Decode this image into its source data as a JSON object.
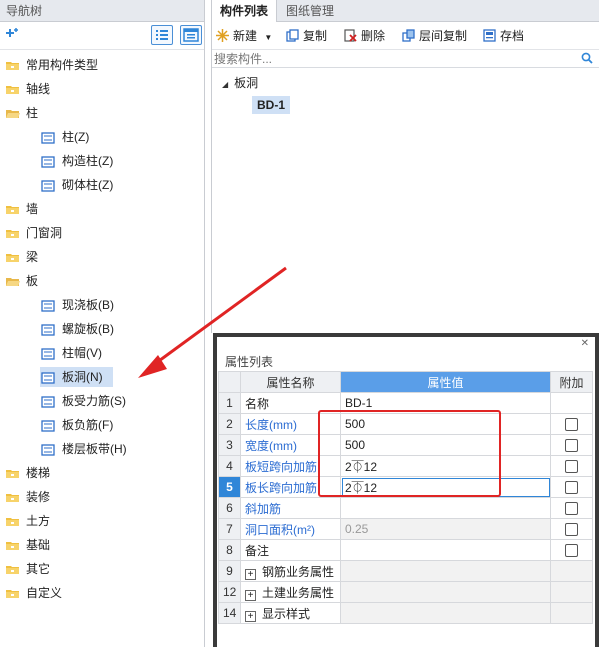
{
  "nav": {
    "title": "导航树",
    "tree": [
      {
        "label": "常用构件类型",
        "kind": "folder"
      },
      {
        "label": "轴线",
        "kind": "folder"
      },
      {
        "label": "柱",
        "kind": "folder-open"
      },
      {
        "label": "柱(Z)",
        "kind": "leaf",
        "icon": "column-icon"
      },
      {
        "label": "构造柱(Z)",
        "kind": "leaf",
        "icon": "construct-column-icon"
      },
      {
        "label": "砌体柱(Z)",
        "kind": "leaf",
        "icon": "masonry-column-icon"
      },
      {
        "label": "墙",
        "kind": "folder"
      },
      {
        "label": "门窗洞",
        "kind": "folder"
      },
      {
        "label": "梁",
        "kind": "folder"
      },
      {
        "label": "板",
        "kind": "folder-open"
      },
      {
        "label": "现浇板(B)",
        "kind": "leaf",
        "icon": "cast-slab-icon"
      },
      {
        "label": "螺旋板(B)",
        "kind": "leaf",
        "icon": "spiral-slab-icon"
      },
      {
        "label": "柱帽(V)",
        "kind": "leaf",
        "icon": "column-cap-icon"
      },
      {
        "label": "板洞(N)",
        "kind": "leaf",
        "icon": "slab-hole-icon",
        "selected": true
      },
      {
        "label": "板受力筋(S)",
        "kind": "leaf",
        "icon": "slab-rebar-icon"
      },
      {
        "label": "板负筋(F)",
        "kind": "leaf",
        "icon": "slab-neg-rebar-icon"
      },
      {
        "label": "楼层板带(H)",
        "kind": "leaf",
        "icon": "floor-strip-icon"
      },
      {
        "label": "楼梯",
        "kind": "folder"
      },
      {
        "label": "装修",
        "kind": "folder"
      },
      {
        "label": "土方",
        "kind": "folder"
      },
      {
        "label": "基础",
        "kind": "folder"
      },
      {
        "label": "其它",
        "kind": "folder"
      },
      {
        "label": "自定义",
        "kind": "folder"
      }
    ]
  },
  "component_panel": {
    "tabs": [
      "构件列表",
      "图纸管理"
    ],
    "toolbar": {
      "new_label": "新建",
      "copy_label": "复制",
      "delete_label": "删除",
      "floor_copy_label": "层间复制",
      "save_label": "存档"
    },
    "search": {
      "placeholder": "搜索构件..."
    },
    "tree": {
      "group_label": "板洞",
      "item_label": "BD-1"
    }
  },
  "property_panel": {
    "title": "属性列表",
    "headers": {
      "name": "属性名称",
      "value": "属性值",
      "extra": "附加"
    },
    "rows": [
      {
        "num": "1",
        "name": "名称",
        "value": "BD-1",
        "has_check": false
      },
      {
        "num": "2",
        "name": "长度(mm)",
        "value": "500",
        "has_check": true
      },
      {
        "num": "3",
        "name": "宽度(mm)",
        "value": "500",
        "has_check": true
      },
      {
        "num": "4",
        "name": "板短跨向加筋",
        "value": "2⏁12",
        "has_check": true
      },
      {
        "num": "5",
        "name": "板长跨向加筋",
        "value": "2⏁12",
        "has_check": true
      },
      {
        "num": "6",
        "name": "斜加筋",
        "value": "",
        "has_check": true
      },
      {
        "num": "7",
        "name": "洞口面积(m²)",
        "value": "0.25",
        "has_check": true
      },
      {
        "num": "8",
        "name": "备注",
        "value": "",
        "has_check": true
      },
      {
        "num": "9",
        "name": "钢筋业务属性",
        "value": "",
        "has_check": false
      },
      {
        "num": "12",
        "name": "土建业务属性",
        "value": "",
        "has_check": false
      },
      {
        "num": "14",
        "name": "显示样式",
        "value": "",
        "has_check": false
      }
    ]
  },
  "colors": {
    "selection": "#cfe0f5",
    "accent_blue": "#2f86d8",
    "annotation_red": "#e02424",
    "folder_yellow": "#f0c040"
  }
}
